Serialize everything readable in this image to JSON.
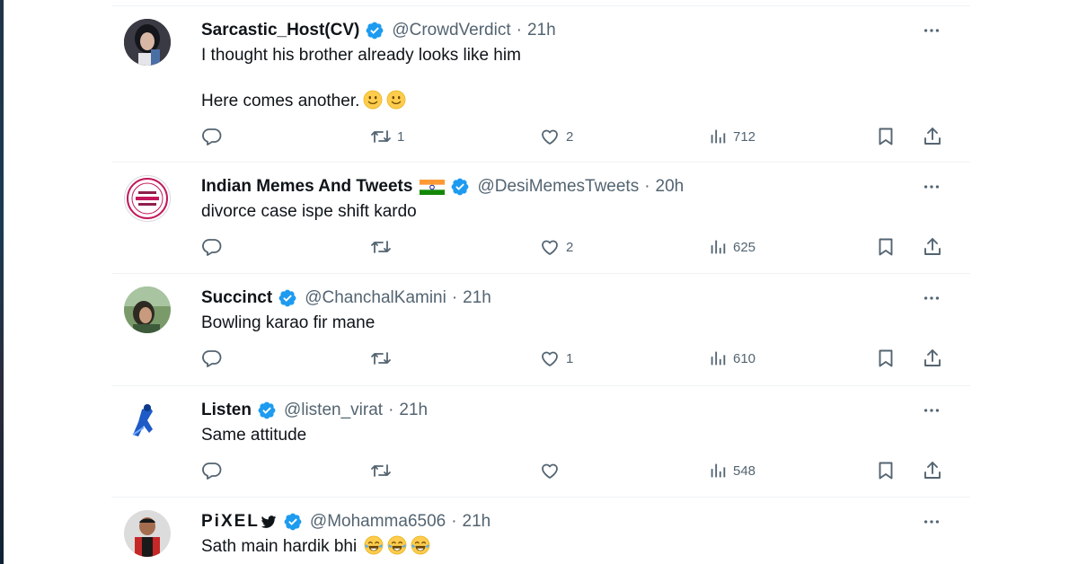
{
  "tweets": [
    {
      "name": "Sarcastic_Host(CV)",
      "handle": "@CrowdVerdict",
      "time": "21h",
      "lines": [
        "I thought his brother already looks like him",
        "Here comes another."
      ],
      "emoji": [
        "slightly-smiling-face",
        "slightly-smiling-face"
      ],
      "retweets": "1",
      "likes": "2",
      "views": "712"
    },
    {
      "name": "Indian Memes And Tweets",
      "flag": "india-flag",
      "handle": "@DesiMemesTweets",
      "time": "20h",
      "lines": [
        "divorce case ispe shift kardo"
      ],
      "retweets": "",
      "likes": "2",
      "views": "625"
    },
    {
      "name": "Succinct",
      "handle": "@ChanchalKamini",
      "time": "21h",
      "lines": [
        "Bowling karao fir mane"
      ],
      "retweets": "",
      "likes": "1",
      "views": "610"
    },
    {
      "name": "Listen",
      "handle": "@listen_virat",
      "time": "21h",
      "lines": [
        "Same attitude"
      ],
      "retweets": "",
      "likes": "",
      "views": "548"
    },
    {
      "name": "PiXEL",
      "name_icon": "twitter-bird-icon",
      "handle": "@Mohamma6506",
      "time": "21h",
      "lines": [
        "Sath main hardik bhi"
      ],
      "emoji": [
        "face-with-tears-of-joy",
        "face-with-tears-of-joy",
        "face-with-tears-of-joy"
      ]
    }
  ],
  "colors": {
    "verified": "#1d9bf0",
    "secondary_text": "#536471",
    "primary_text": "#0f1419",
    "divider": "#eff3f4"
  }
}
